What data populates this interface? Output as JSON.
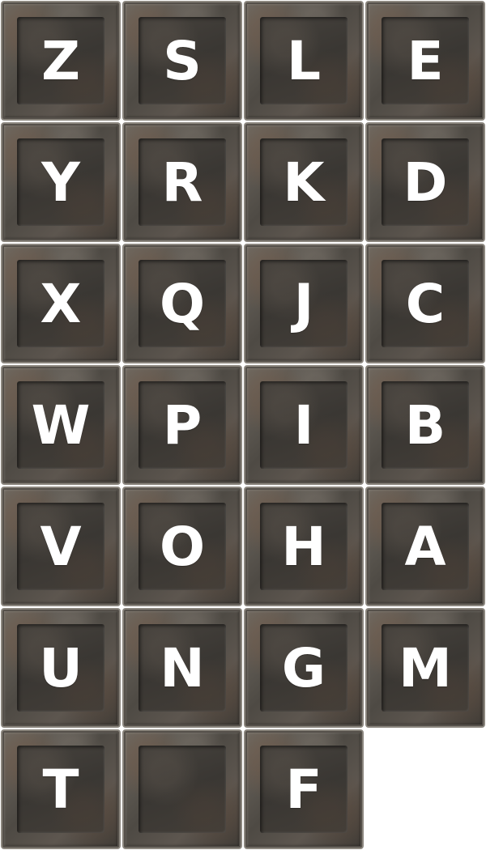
{
  "tiles": [
    {
      "letter": "Z"
    },
    {
      "letter": "S"
    },
    {
      "letter": "L"
    },
    {
      "letter": "E"
    },
    {
      "letter": "Y"
    },
    {
      "letter": "R"
    },
    {
      "letter": "K"
    },
    {
      "letter": "D"
    },
    {
      "letter": "X"
    },
    {
      "letter": "Q"
    },
    {
      "letter": "J"
    },
    {
      "letter": "C"
    },
    {
      "letter": "W"
    },
    {
      "letter": "P"
    },
    {
      "letter": "I"
    },
    {
      "letter": "B"
    },
    {
      "letter": "V"
    },
    {
      "letter": "O"
    },
    {
      "letter": "H"
    },
    {
      "letter": "A"
    },
    {
      "letter": "U"
    },
    {
      "letter": "N"
    },
    {
      "letter": "G"
    },
    {
      "letter": "M"
    },
    {
      "letter": "T"
    },
    {
      "letter": ""
    },
    {
      "letter": "F"
    }
  ],
  "colors": {
    "letter": "#ffffff",
    "tile_stone": "#5a554e",
    "background": "#ffffff"
  }
}
